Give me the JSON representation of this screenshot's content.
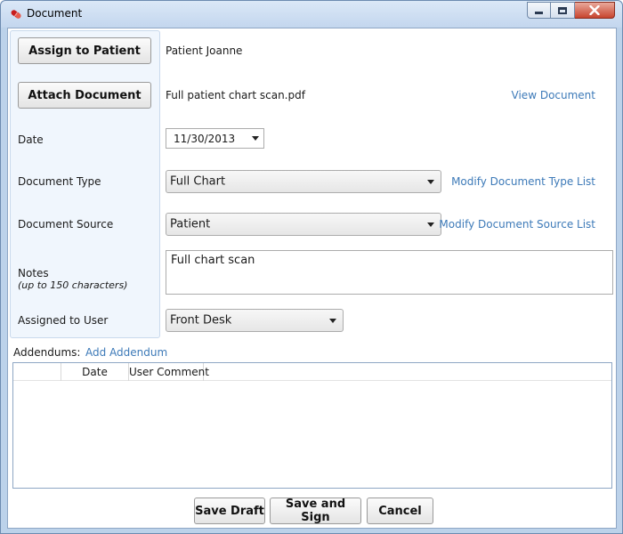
{
  "window": {
    "title": "Document",
    "controls": {
      "minimize": "minimize",
      "maximize": "maximize",
      "close": "close"
    }
  },
  "buttons": {
    "assign_patient": "Assign to Patient",
    "attach_document": "Attach Document",
    "save_draft": "Save Draft",
    "save_and_sign": "Save and Sign",
    "cancel": "Cancel"
  },
  "patient": {
    "name": "Patient Joanne"
  },
  "document": {
    "file_name": "Full patient chart scan.pdf",
    "view_link": "View Document"
  },
  "fields": {
    "date": {
      "label": "Date",
      "value": "11/30/2013"
    },
    "document_type": {
      "label": "Document Type",
      "value": "Full Chart",
      "modify_link": "Modify Document Type List"
    },
    "document_source": {
      "label": "Document Source",
      "value": "Patient",
      "modify_link": "Modify Document Source List"
    },
    "notes": {
      "label": "Notes",
      "hint": "(up to 150 characters)",
      "value": "Full chart scan"
    },
    "assigned_user": {
      "label": "Assigned to User",
      "value": "Front Desk"
    }
  },
  "addendums": {
    "label": "Addendums:",
    "add_link": "Add Addendum",
    "columns": [
      "",
      "Date",
      "User Comment"
    ],
    "rows": []
  },
  "colors": {
    "link": "#3d7ab8",
    "panel": "#f0f6fd",
    "frame": "#bcd2ea"
  }
}
